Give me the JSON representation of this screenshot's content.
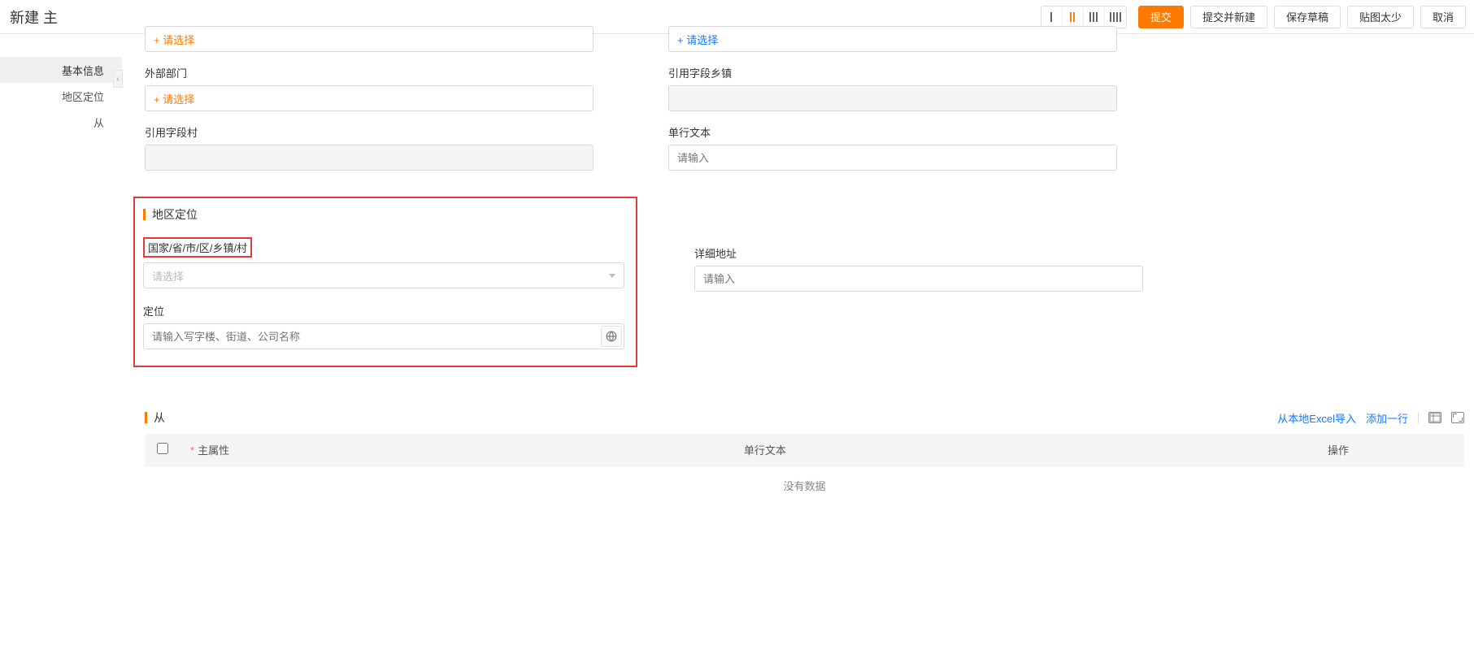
{
  "header": {
    "title": "新建 主",
    "buttons": {
      "submit": "提交",
      "submit_new": "提交并新建",
      "save_draft": "保存草稿",
      "paste_less": "贴图太少",
      "cancel": "取消"
    }
  },
  "sidebar": {
    "items": [
      {
        "label": "基本信息",
        "active": true
      },
      {
        "label": "地区定位",
        "active": false
      },
      {
        "label": "从",
        "active": false
      }
    ]
  },
  "form": {
    "select_placeholder_plus": "+ 请选择",
    "select_placeholder": "请选择",
    "input_placeholder": "请输入",
    "basic": {
      "ext_dept_label": "外部部门",
      "ref_village_label": "引用字段村",
      "ref_town_label": "引用字段乡镇",
      "single_text_label": "单行文本"
    },
    "region": {
      "heading": "地区定位",
      "cascade_label": "国家/省/市/区/乡镇/村",
      "location_label": "定位",
      "location_placeholder": "请输入写字楼、街道、公司名称",
      "detail_label": "详细地址"
    }
  },
  "subtable": {
    "heading": "从",
    "import_excel": "从本地Excel导入",
    "add_row": "添加一行",
    "columns": {
      "main_attr": "主属性",
      "single_text": "单行文本",
      "op": "操作"
    },
    "empty": "没有数据"
  }
}
